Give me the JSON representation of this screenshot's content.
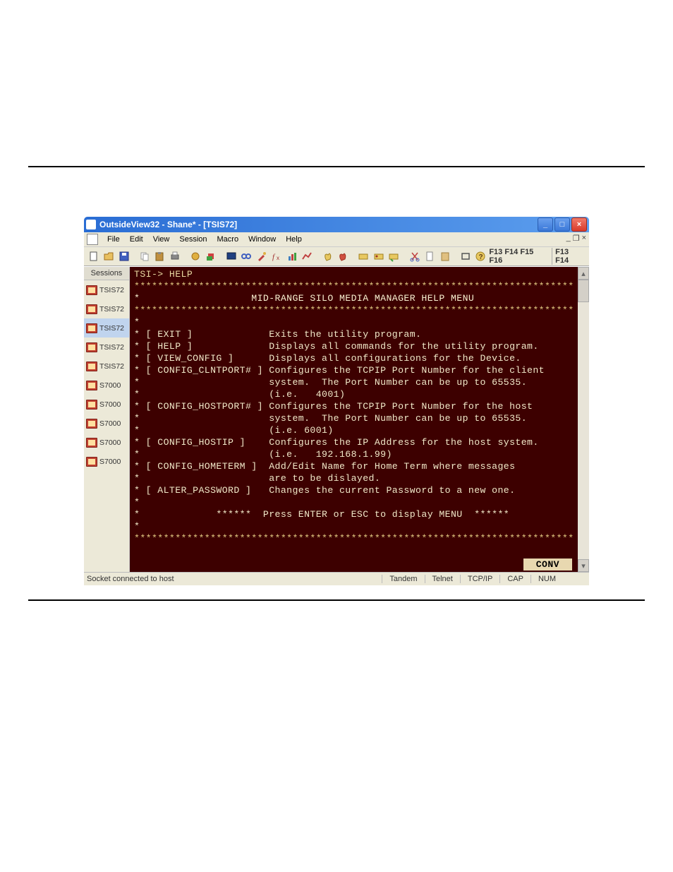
{
  "window": {
    "title": "OutsideView32 - Shane* - [TSIS72]"
  },
  "menus": [
    "File",
    "Edit",
    "View",
    "Session",
    "Macro",
    "Window",
    "Help"
  ],
  "fkeys_right1": "F13 F14 F15 F16",
  "fkeys_right2": "F13 F14",
  "sidebar": {
    "header": "Sessions",
    "items": [
      {
        "label": "TSIS72",
        "selected": false
      },
      {
        "label": "TSIS72",
        "selected": false
      },
      {
        "label": "TSIS72",
        "selected": true
      },
      {
        "label": "TSIS72",
        "selected": false
      },
      {
        "label": "TSIS72",
        "selected": false
      },
      {
        "label": "S7000",
        "selected": false
      },
      {
        "label": "S7000",
        "selected": false
      },
      {
        "label": "S7000",
        "selected": false
      },
      {
        "label": "S7000",
        "selected": false
      },
      {
        "label": "S7000",
        "selected": false
      }
    ]
  },
  "terminal": {
    "prompt": "TSI-> HELP",
    "title": "MID-RANGE SILO MEDIA MANAGER HELP MENU",
    "commands": [
      {
        "cmd": "[ EXIT ]",
        "desc": [
          "Exits the utility program."
        ]
      },
      {
        "cmd": "[ HELP ]",
        "desc": [
          "Displays all commands for the utility program."
        ]
      },
      {
        "cmd": "[ VIEW_CONFIG ]",
        "desc": [
          "Displays all configurations for the Device."
        ]
      },
      {
        "cmd": "[ CONFIG_CLNTPORT# ]",
        "desc": [
          "Configures the TCPIP Port Number for the client",
          "system.  The Port Number can be up to 65535.",
          "(i.e.   4001)"
        ]
      },
      {
        "cmd": "[ CONFIG_HOSTPORT# ]",
        "desc": [
          "Configures the TCPIP Port Number for the host",
          "system.  The Port Number can be up to 65535.",
          "(i.e. 6001)"
        ]
      },
      {
        "cmd": "[ CONFIG_HOSTIP ]",
        "desc": [
          "Configures the IP Address for the host system.",
          "(i.e.   192.168.1.99)"
        ]
      },
      {
        "cmd": "[ CONFIG_HOMETERM ]",
        "desc": [
          "Add/Edit Name for Home Term where messages",
          "are to be dislayed."
        ]
      },
      {
        "cmd": "[ ALTER_PASSWORD ]",
        "desc": [
          "Changes the current Password to a new one."
        ]
      }
    ],
    "footer": "******  Press ENTER or ESC to display MENU  ******",
    "conv": "CONV"
  },
  "status": {
    "text": "Socket connected to host",
    "cells": [
      "Tandem",
      "Telnet",
      "TCP/IP",
      "CAP",
      "NUM",
      ""
    ]
  },
  "toolbar_icons": [
    "new",
    "open",
    "save",
    "",
    "copy",
    "paste",
    "print",
    "",
    "settings",
    "wizard",
    "",
    "screen",
    "link",
    "tools",
    "fx",
    "bars",
    "chart",
    "",
    "hand1",
    "hand2",
    "",
    "key1",
    "key2",
    "key3",
    "",
    "cut",
    "doc",
    "clip",
    "",
    "rect",
    "help"
  ]
}
